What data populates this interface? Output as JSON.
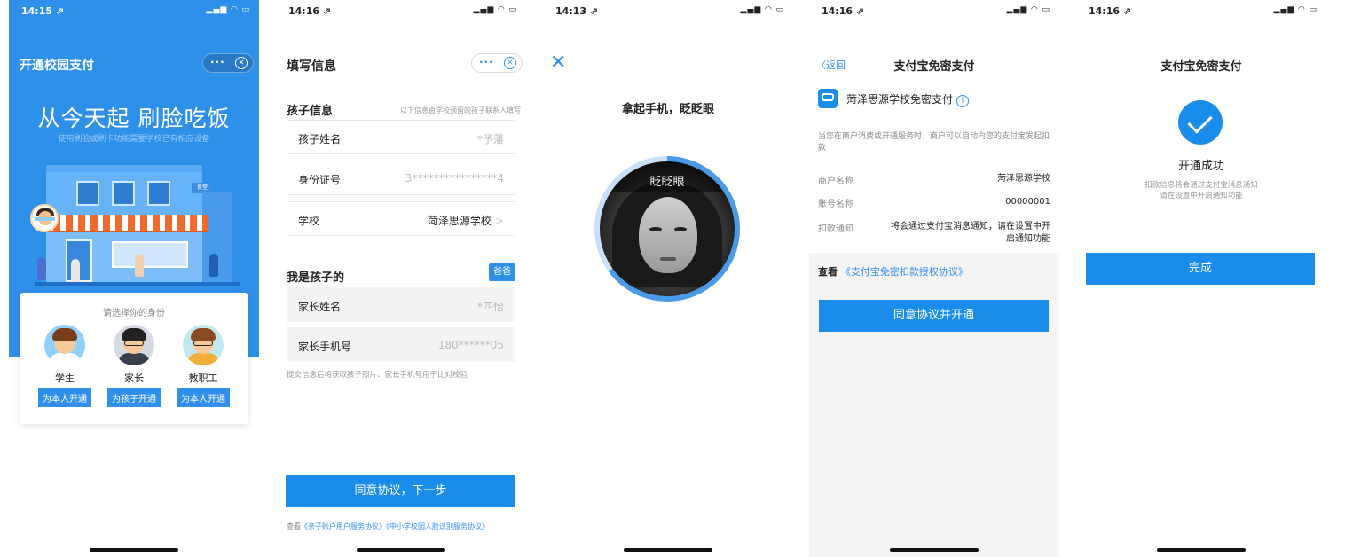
{
  "phone1": {
    "time": "14:15 ⇗",
    "status_icons": "▂▄▆ ◠ ▭",
    "nav_title": "开通校园支付",
    "more": "···",
    "close": "✕",
    "slogan": "从今天起 刷脸吃饭",
    "subslogan": "使用刷脸或刷卡功能需要学校已有相应设备",
    "shop_sign": "食堂",
    "prompt": "请选择你的身份",
    "roles": [
      {
        "label": "学生",
        "button": "为本人开通"
      },
      {
        "label": "家长",
        "button": "为孩子开通"
      },
      {
        "label": "教职工",
        "button": "为本人开通"
      }
    ],
    "colors": {
      "brand": "#2f90ea",
      "awning": "#f06a30"
    }
  },
  "phone2": {
    "time": "14:16 ⇗",
    "status_icons": "▂▄▆ ◠ ▭",
    "nav_title": "填写信息",
    "more": "···",
    "close": "✕",
    "child_section_title": "孩子信息",
    "child_section_hint": "以下信息由学校预留的孩子联系人填写",
    "fields": [
      {
        "label": "孩子姓名",
        "value": "*予藩"
      },
      {
        "label": "身份证号",
        "value": "3****************4"
      },
      {
        "label": "学校",
        "value": "菏泽思源学校",
        "chevron": ">"
      }
    ],
    "parent_section_title": "我是孩子的",
    "relation": "爸爸",
    "parent_fields": [
      {
        "label": "家长姓名",
        "value": "*四怡"
      },
      {
        "label": "家长手机号",
        "value": "180******05"
      }
    ],
    "verify_note": "提交信息后将获取孩子照片、家长手机号用于比对校验",
    "submit": "同意协议，下一步",
    "agree_prefix": "查看",
    "agree_link1": "《亲子账户用户服务协议》",
    "agree_link2": "《中小学校园人脸识别服务协议》"
  },
  "phone3": {
    "time": "14:13 ⇗",
    "status_icons": "▂▄▆ ◠ ▭",
    "close": "✕",
    "instruction": "拿起手机，眨眨眼",
    "face_banner": "眨眨眼",
    "scan_progress": 0.65
  },
  "phone4": {
    "time": "14:16 ⇗",
    "status_icons": "▂▄▆ ◠ ▭",
    "back": "〈返回",
    "nav_title": "支付宝免密支付",
    "merchant_title": "菏泽思源学校免密支付",
    "info_icon": "i",
    "auth_desc": "当您在商户消费或开通服务时，商户可以自动向您的支付宝发起扣款",
    "rows": [
      {
        "k": "商户名称",
        "v": "菏泽思源学校"
      },
      {
        "k": "账号名称",
        "v": "00000001"
      },
      {
        "k": "扣款通知",
        "v": "将会通过支付宝消息通知，请在设置中开启通知功能"
      }
    ],
    "view_prefix": "查看",
    "view_link": "《支付宝免密扣款授权协议》",
    "agree_button": "同意协议并开通"
  },
  "phone5": {
    "time": "14:16 ⇗",
    "status_icons": "▂▄▆ ◠ ▭",
    "nav_title": "支付宝免密支付",
    "success_title": "开通成功",
    "note1": "扣款信息将会通过支付宝消息通知",
    "note2": "请在设置中开启通知功能",
    "done": "完成"
  }
}
